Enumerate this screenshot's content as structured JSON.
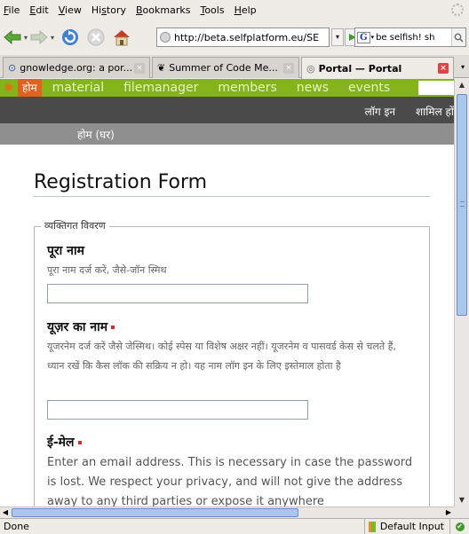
{
  "menu": [
    {
      "key": "F",
      "rest": "ile"
    },
    {
      "key": "E",
      "rest": "dit"
    },
    {
      "key": "V",
      "rest": "iew"
    },
    {
      "pre": "Hi",
      "key": "s",
      "rest": "tory"
    },
    {
      "key": "B",
      "rest": "ookmarks"
    },
    {
      "key": "T",
      "rest": "ools"
    },
    {
      "key": "H",
      "rest": "elp"
    }
  ],
  "navbar": {
    "url": "http://beta.selfplatform.eu/SE",
    "search_query": "be selfish! sh",
    "search_engine": "G"
  },
  "tabs": [
    {
      "icon": "clock-icon",
      "glyph": "⊙",
      "label": "gnowledge.org: a por...",
      "active": false
    },
    {
      "icon": "gnu-icon",
      "glyph": "❦",
      "label": "Summer of Code Me...",
      "active": false
    },
    {
      "icon": "globe-icon",
      "glyph": "◎",
      "label": "Portal — Portal",
      "active": true
    }
  ],
  "site": {
    "nav": {
      "home": "होम",
      "items": [
        "material",
        "filemanager",
        "members",
        "news",
        "events"
      ]
    },
    "auth": {
      "login": "लॉग इन",
      "join": "शामिल हों"
    },
    "breadcrumb": "होम (घर)"
  },
  "form": {
    "title": "Registration Form",
    "legend": "व्यक्तिगत विवरण",
    "fullname": {
      "label": "पूरा नाम",
      "help": "पूरा नाम दर्ज करें, जैसे-जॉन स्मिथ",
      "value": ""
    },
    "username": {
      "label": "यूज़र का नाम",
      "help": "यूजरनेम दर्ज करें जैसे जेस्मिथ। कोई स्पेस या विशेष अक्षर नहीं। यूजरनेम व पासवर्ड केस से चलते हैं, ध्यान रखें कि कैस लॉक की सक्रिय न हो। यह नाम लॉग इन के लिए इस्तेमाल होता है",
      "value": ""
    },
    "email": {
      "label": "ई-मेल",
      "help": "Enter an email address. This is necessary in case the password is lost. We respect your privacy, and will not give the address away to any third parties or expose it anywhere"
    }
  },
  "status": {
    "text": "Done",
    "input_method": "Default Input"
  },
  "colors": {
    "site_nav": "#85b41a",
    "home_tab": "#e1611f",
    "auth_bar": "#4a4a4a",
    "crumb_bar": "#8f8f8f",
    "required": "#e5252a"
  }
}
